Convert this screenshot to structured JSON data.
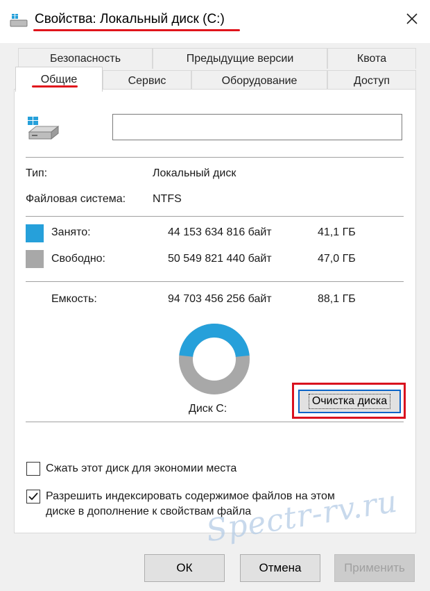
{
  "window": {
    "title": "Свойства: Локальный диск (C:)"
  },
  "tabs": {
    "row1": [
      {
        "label": "Безопасность"
      },
      {
        "label": "Предыдущие версии"
      },
      {
        "label": "Квота"
      }
    ],
    "row2": [
      {
        "label": "Общие",
        "active": true
      },
      {
        "label": "Сервис"
      },
      {
        "label": "Оборудование"
      },
      {
        "label": "Доступ"
      }
    ]
  },
  "general": {
    "name_value": "",
    "type_label": "Тип:",
    "type_value": "Локальный диск",
    "fs_label": "Файловая система:",
    "fs_value": "NTFS",
    "used": {
      "label": "Занято:",
      "bytes": "44 153 634 816 байт",
      "size": "41,1 ГБ",
      "color": "#26a0da"
    },
    "free": {
      "label": "Свободно:",
      "bytes": "50 549 821 440 байт",
      "size": "47,0 ГБ",
      "color": "#a8a8a8"
    },
    "capacity": {
      "label": "Емкость:",
      "bytes": "94 703 456 256 байт",
      "size": "88,1 ГБ"
    },
    "used_fraction": 0.466,
    "drive_label": "Диск C:",
    "cleanup_button": "Очистка диска",
    "compress": {
      "label": "Сжать этот диск для экономии места",
      "checked": false
    },
    "index": {
      "label_line1": "Разрешить индексировать содержимое файлов на этом",
      "label_line2": "диске в дополнение к свойствам файла",
      "checked": true
    }
  },
  "watermark": "Spectr-rv.ru",
  "buttons": {
    "ok": "ОК",
    "cancel": "Отмена",
    "apply": "Применить"
  }
}
